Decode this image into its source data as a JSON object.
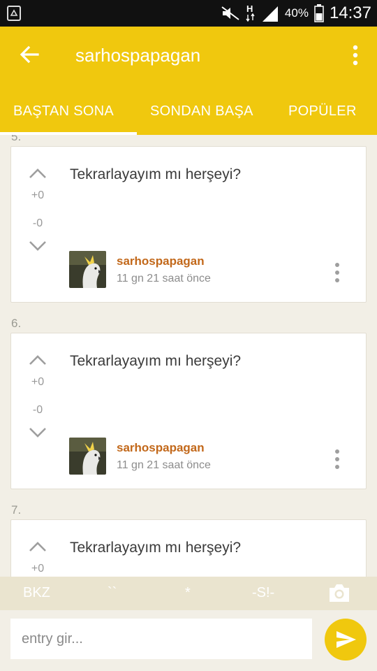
{
  "status_bar": {
    "battery": "40%",
    "time": "14:37",
    "icons": [
      "recycle-icon",
      "mute-icon",
      "network-h-icon",
      "signal-icon",
      "battery-icon"
    ]
  },
  "app_bar": {
    "title": "sarhospapagan",
    "back_icon": "arrow-back-icon",
    "menu_icon": "overflow-menu-icon"
  },
  "tabs": [
    {
      "label": "BAŞTAN SONA",
      "active": true
    },
    {
      "label": "SONDAN BAŞA",
      "active": false
    },
    {
      "label": "POPÜLER",
      "active": false
    }
  ],
  "entries": [
    {
      "index": "5.",
      "text": "Tekrarlayayım mı herşeyi?",
      "up": "+0",
      "down": "-0",
      "author": "sarhospapagan",
      "time": "11 gn 21 saat  önce"
    },
    {
      "index": "6.",
      "text": "Tekrarlayayım mı herşeyi?",
      "up": "+0",
      "down": "-0",
      "author": "sarhospapagan",
      "time": "11 gn 21 saat  önce"
    },
    {
      "index": "7.",
      "text": "Tekrarlayayım mı herşeyi?",
      "up": "+0",
      "down": "",
      "author": "",
      "time": ""
    }
  ],
  "shortcuts": {
    "bkz": "BKZ",
    "backtick": "``",
    "star": "*",
    "spoiler": "-S!-",
    "camera_icon": "camera-icon"
  },
  "composer": {
    "placeholder": "entry gir...",
    "send_icon": "send-icon"
  },
  "colors": {
    "accent": "#f0c80e",
    "author": "#c2681a",
    "background": "#f2efe6"
  }
}
